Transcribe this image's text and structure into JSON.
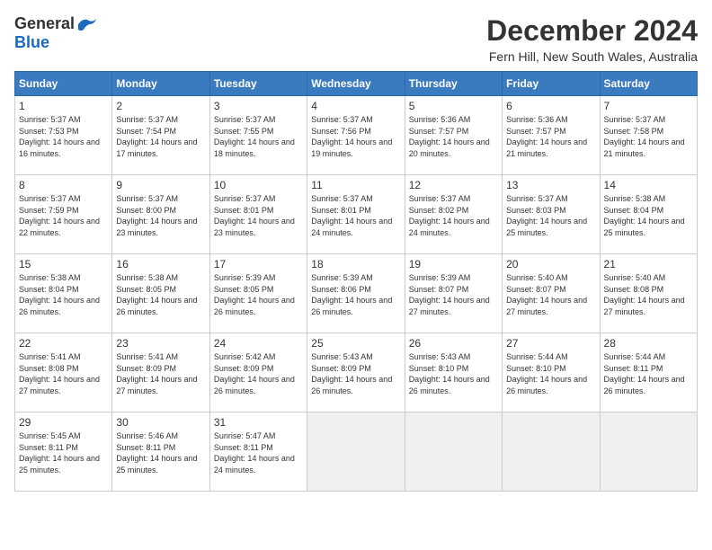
{
  "logo": {
    "general": "General",
    "blue": "Blue"
  },
  "title": "December 2024",
  "location": "Fern Hill, New South Wales, Australia",
  "headers": [
    "Sunday",
    "Monday",
    "Tuesday",
    "Wednesday",
    "Thursday",
    "Friday",
    "Saturday"
  ],
  "weeks": [
    [
      {
        "day": "1",
        "sunrise": "5:37 AM",
        "sunset": "7:53 PM",
        "daylight": "14 hours and 16 minutes."
      },
      {
        "day": "2",
        "sunrise": "5:37 AM",
        "sunset": "7:54 PM",
        "daylight": "14 hours and 17 minutes."
      },
      {
        "day": "3",
        "sunrise": "5:37 AM",
        "sunset": "7:55 PM",
        "daylight": "14 hours and 18 minutes."
      },
      {
        "day": "4",
        "sunrise": "5:37 AM",
        "sunset": "7:56 PM",
        "daylight": "14 hours and 19 minutes."
      },
      {
        "day": "5",
        "sunrise": "5:36 AM",
        "sunset": "7:57 PM",
        "daylight": "14 hours and 20 minutes."
      },
      {
        "day": "6",
        "sunrise": "5:36 AM",
        "sunset": "7:57 PM",
        "daylight": "14 hours and 21 minutes."
      },
      {
        "day": "7",
        "sunrise": "5:37 AM",
        "sunset": "7:58 PM",
        "daylight": "14 hours and 21 minutes."
      }
    ],
    [
      {
        "day": "8",
        "sunrise": "5:37 AM",
        "sunset": "7:59 PM",
        "daylight": "14 hours and 22 minutes."
      },
      {
        "day": "9",
        "sunrise": "5:37 AM",
        "sunset": "8:00 PM",
        "daylight": "14 hours and 23 minutes."
      },
      {
        "day": "10",
        "sunrise": "5:37 AM",
        "sunset": "8:01 PM",
        "daylight": "14 hours and 23 minutes."
      },
      {
        "day": "11",
        "sunrise": "5:37 AM",
        "sunset": "8:01 PM",
        "daylight": "14 hours and 24 minutes."
      },
      {
        "day": "12",
        "sunrise": "5:37 AM",
        "sunset": "8:02 PM",
        "daylight": "14 hours and 24 minutes."
      },
      {
        "day": "13",
        "sunrise": "5:37 AM",
        "sunset": "8:03 PM",
        "daylight": "14 hours and 25 minutes."
      },
      {
        "day": "14",
        "sunrise": "5:38 AM",
        "sunset": "8:04 PM",
        "daylight": "14 hours and 25 minutes."
      }
    ],
    [
      {
        "day": "15",
        "sunrise": "5:38 AM",
        "sunset": "8:04 PM",
        "daylight": "14 hours and 26 minutes."
      },
      {
        "day": "16",
        "sunrise": "5:38 AM",
        "sunset": "8:05 PM",
        "daylight": "14 hours and 26 minutes."
      },
      {
        "day": "17",
        "sunrise": "5:39 AM",
        "sunset": "8:05 PM",
        "daylight": "14 hours and 26 minutes."
      },
      {
        "day": "18",
        "sunrise": "5:39 AM",
        "sunset": "8:06 PM",
        "daylight": "14 hours and 26 minutes."
      },
      {
        "day": "19",
        "sunrise": "5:39 AM",
        "sunset": "8:07 PM",
        "daylight": "14 hours and 27 minutes."
      },
      {
        "day": "20",
        "sunrise": "5:40 AM",
        "sunset": "8:07 PM",
        "daylight": "14 hours and 27 minutes."
      },
      {
        "day": "21",
        "sunrise": "5:40 AM",
        "sunset": "8:08 PM",
        "daylight": "14 hours and 27 minutes."
      }
    ],
    [
      {
        "day": "22",
        "sunrise": "5:41 AM",
        "sunset": "8:08 PM",
        "daylight": "14 hours and 27 minutes."
      },
      {
        "day": "23",
        "sunrise": "5:41 AM",
        "sunset": "8:09 PM",
        "daylight": "14 hours and 27 minutes."
      },
      {
        "day": "24",
        "sunrise": "5:42 AM",
        "sunset": "8:09 PM",
        "daylight": "14 hours and 26 minutes."
      },
      {
        "day": "25",
        "sunrise": "5:43 AM",
        "sunset": "8:09 PM",
        "daylight": "14 hours and 26 minutes."
      },
      {
        "day": "26",
        "sunrise": "5:43 AM",
        "sunset": "8:10 PM",
        "daylight": "14 hours and 26 minutes."
      },
      {
        "day": "27",
        "sunrise": "5:44 AM",
        "sunset": "8:10 PM",
        "daylight": "14 hours and 26 minutes."
      },
      {
        "day": "28",
        "sunrise": "5:44 AM",
        "sunset": "8:11 PM",
        "daylight": "14 hours and 26 minutes."
      }
    ],
    [
      {
        "day": "29",
        "sunrise": "5:45 AM",
        "sunset": "8:11 PM",
        "daylight": "14 hours and 25 minutes."
      },
      {
        "day": "30",
        "sunrise": "5:46 AM",
        "sunset": "8:11 PM",
        "daylight": "14 hours and 25 minutes."
      },
      {
        "day": "31",
        "sunrise": "5:47 AM",
        "sunset": "8:11 PM",
        "daylight": "14 hours and 24 minutes."
      },
      null,
      null,
      null,
      null
    ]
  ],
  "labels": {
    "sunrise": "Sunrise:",
    "sunset": "Sunset:",
    "daylight": "Daylight: "
  }
}
